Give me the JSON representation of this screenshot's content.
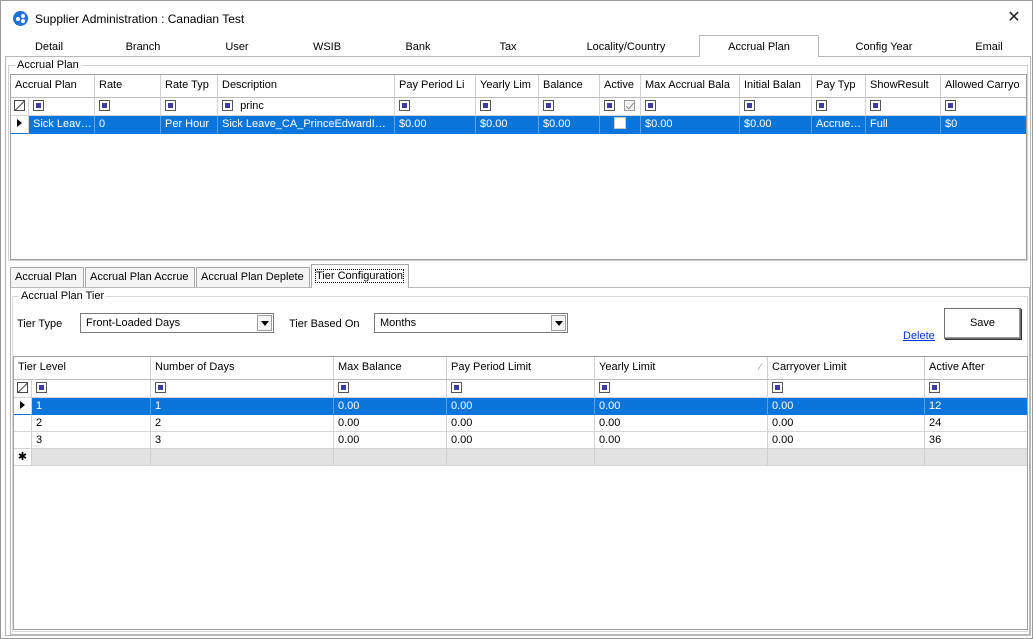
{
  "window": {
    "title": "Supplier Administration : Canadian Test",
    "close_glyph": "✕",
    "icon": "app-logo-icon"
  },
  "tabs": [
    "Detail",
    "Branch",
    "User",
    "WSIB",
    "Bank",
    "Tax",
    "Locality/Country",
    "Accrual Plan",
    "Config Year",
    "Email"
  ],
  "active_tab": "Accrual Plan",
  "accrual_plan_group": {
    "label": "Accrual Plan",
    "columns": [
      "Accrual Plan",
      "Rate",
      "Rate Typ",
      "Description",
      "Pay Period Li",
      "Yearly Lim",
      "Balance",
      "Active",
      "Max Accrual Bala",
      "Initial Balan",
      "Pay Typ",
      "ShowResult",
      "Allowed Carryo"
    ],
    "filter_description": "princ",
    "rows": [
      {
        "accrual_plan": "Sick Leav…",
        "rate": "0",
        "rate_type": "Per Hour",
        "description": "Sick Leave_CA_PrinceEdwardI…",
        "pay_period_limit": "$0.00",
        "yearly_limit": "$0.00",
        "balance": "$0.00",
        "active": false,
        "max_accrual_balance": "$0.00",
        "initial_balance": "$0.00",
        "pay_type": "Accrue…",
        "show_result": "Full",
        "allowed_carryover": "$0"
      }
    ]
  },
  "sub_tabs": [
    "Accrual  Plan",
    "Accrual Plan Accrue",
    "Accrual Plan Deplete",
    "Tier Configuration"
  ],
  "active_sub_tab": "Tier Configuration",
  "tier_group": {
    "label": "Accrual Plan Tier",
    "tier_type_label": "Tier Type",
    "tier_type_value": "Front-Loaded Days",
    "tier_based_on_label": "Tier Based On",
    "tier_based_on_value": "Months",
    "delete_label": "Delete",
    "save_label": "Save",
    "columns": [
      "Tier Level",
      "Number of Days",
      "Max Balance",
      "Pay Period Limit",
      "Yearly Limit",
      "Carryover Limit",
      "Active After"
    ],
    "rows": [
      {
        "tier_level": "1",
        "number_of_days": "1",
        "max_balance": "0.00",
        "pay_period_limit": "0.00",
        "yearly_limit": "0.00",
        "carryover_limit": "0.00",
        "active_after": "12"
      },
      {
        "tier_level": "2",
        "number_of_days": "2",
        "max_balance": "0.00",
        "pay_period_limit": "0.00",
        "yearly_limit": "0.00",
        "carryover_limit": "0.00",
        "active_after": "24"
      },
      {
        "tier_level": "3",
        "number_of_days": "3",
        "max_balance": "0.00",
        "pay_period_limit": "0.00",
        "yearly_limit": "0.00",
        "carryover_limit": "0.00",
        "active_after": "36"
      }
    ],
    "new_row_glyph": "✱",
    "sort_glyph": "⁄"
  },
  "colors": {
    "selection": "#0a76dc",
    "link": "#0033cc",
    "new_row": "#e2e2e2"
  }
}
